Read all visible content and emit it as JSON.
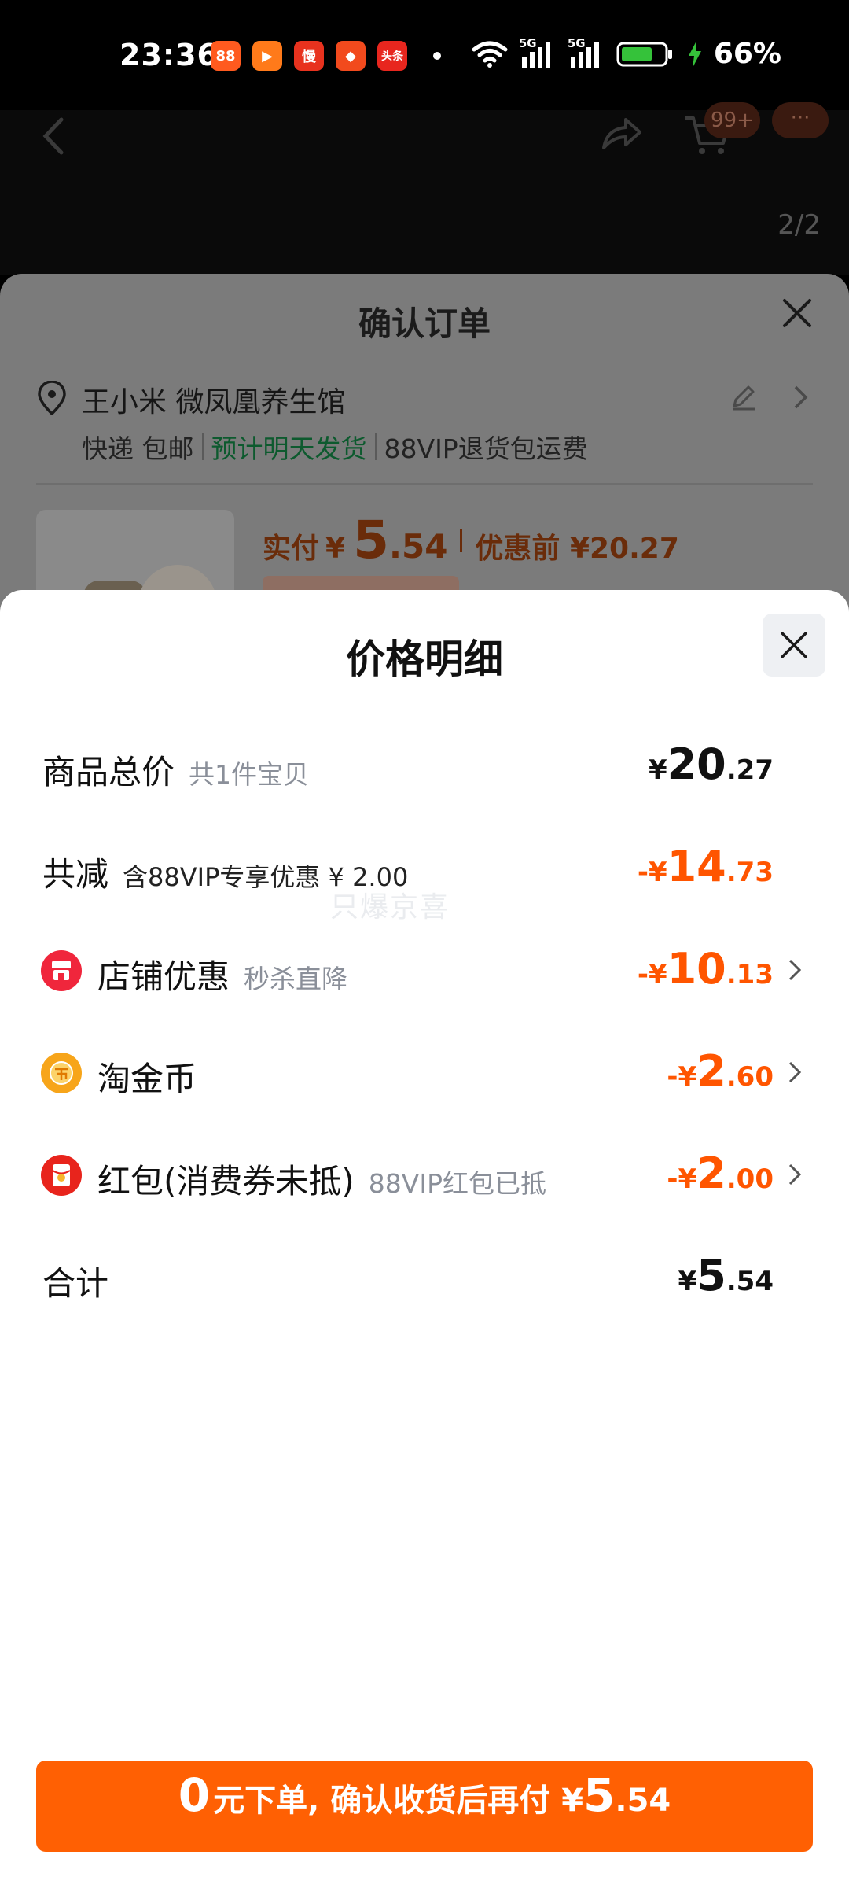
{
  "status_bar": {
    "time": "23:36",
    "apps": [
      {
        "name": "app-1-icon",
        "color": "#ff5a1f",
        "glyph": "88"
      },
      {
        "name": "app-2-icon",
        "color": "#ff7a1a",
        "glyph": "▶"
      },
      {
        "name": "app-3-icon",
        "color": "#e8321e",
        "glyph": "慢"
      },
      {
        "name": "app-4-icon",
        "color": "#f24a1d",
        "glyph": "◆"
      },
      {
        "name": "app-5-icon",
        "color": "#e8261e",
        "glyph": "头条"
      }
    ],
    "network_1": "5G",
    "network_2": "5G",
    "battery": "66%"
  },
  "background_page": {
    "cart_badge": "99+",
    "more_badge": "···",
    "image_counter": "2/2"
  },
  "order_sheet": {
    "title": "确认订单",
    "address_name": "王小米 微凤凰养生馆",
    "shipping_method": "快递 包邮",
    "shipping_eta": "预计明天发货",
    "return_note": "88VIP退货包运费",
    "paid_label": "实付",
    "paid_yen": "¥",
    "paid_int": "5",
    "paid_dec": ".54",
    "before_discount": "优惠前 ¥20.27"
  },
  "detail_sheet": {
    "title": "价格明细",
    "rows": {
      "total": {
        "label": "商品总价",
        "sub": "共1件宝贝",
        "yen": "¥",
        "int": "20",
        "dec": ".27"
      },
      "reduce": {
        "label": "共减",
        "sub": "含88VIP专享优惠 ¥ 2.00",
        "yen": "-¥",
        "int": "14",
        "dec": ".73"
      },
      "shop": {
        "label": "店铺优惠",
        "sub": "秒杀直降",
        "yen": "-¥",
        "int": "10",
        "dec": ".13"
      },
      "coin": {
        "label": "淘金币",
        "sub": "",
        "yen": "-¥",
        "int": "2",
        "dec": ".60"
      },
      "redpacket": {
        "label": "红包(消费券未抵)",
        "sub": "88VIP红包已抵",
        "yen": "-¥",
        "int": "2",
        "dec": ".00"
      },
      "sum": {
        "label": "合计",
        "yen": "¥",
        "int": "5",
        "dec": ".54"
      }
    },
    "watermark": "只爆京喜"
  },
  "bottom_button": {
    "big": "0",
    "text": "元下单, 确认收货后再付",
    "yen": "¥",
    "int": "5",
    "dec": ".54"
  },
  "colors": {
    "accent": "#ff5500",
    "button": "#ff6003",
    "shop_icon": "#f0263c",
    "coin_icon": "#f7a51a",
    "redpacket_icon": "#e8241c"
  }
}
